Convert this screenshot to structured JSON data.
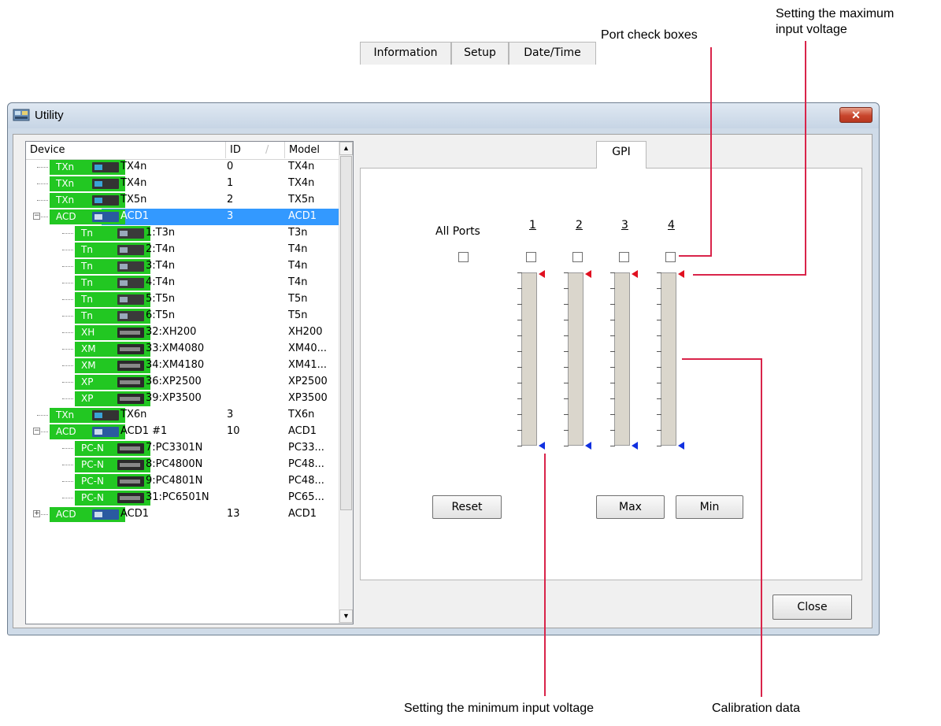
{
  "callouts": {
    "port_check_boxes": "Port check boxes",
    "max_voltage_line1": "Setting the maximum",
    "max_voltage_line2": "input voltage",
    "min_voltage": "Setting the minimum input voltage",
    "calibration": "Calibration data"
  },
  "window": {
    "title": "Utility",
    "close_glyph": "✕"
  },
  "tree": {
    "columns": {
      "device": "Device",
      "id": "ID",
      "sort_glyph": "/",
      "model": "Model"
    },
    "rows": [
      {
        "tag": "TXn",
        "label": "TX4n",
        "id": "0",
        "model": "TX4n",
        "level": 1,
        "thumb": "amp"
      },
      {
        "tag": "TXn",
        "label": "TX4n",
        "id": "1",
        "model": "TX4n",
        "level": 1,
        "thumb": "amp"
      },
      {
        "tag": "TXn",
        "label": "TX5n",
        "id": "2",
        "model": "TX5n",
        "level": 1,
        "thumb": "amp"
      },
      {
        "tag": "ACD",
        "label": "ACD1",
        "id": "3",
        "model": "ACD1",
        "level": 1,
        "thumb": "acd",
        "expander": "−",
        "selected": true
      },
      {
        "tag": "Tn",
        "label": "1:T3n",
        "id": "",
        "model": "T3n",
        "level": 2,
        "thumb": "tn"
      },
      {
        "tag": "Tn",
        "label": "2:T4n",
        "id": "",
        "model": "T4n",
        "level": 2,
        "thumb": "tn"
      },
      {
        "tag": "Tn",
        "label": "3:T4n",
        "id": "",
        "model": "T4n",
        "level": 2,
        "thumb": "tn"
      },
      {
        "tag": "Tn",
        "label": "4:T4n",
        "id": "",
        "model": "T4n",
        "level": 2,
        "thumb": "tn"
      },
      {
        "tag": "Tn",
        "label": "5:T5n",
        "id": "",
        "model": "T5n",
        "level": 2,
        "thumb": "tn"
      },
      {
        "tag": "Tn",
        "label": "6:T5n",
        "id": "",
        "model": "T5n",
        "level": 2,
        "thumb": "tn"
      },
      {
        "tag": "XH",
        "label": "32:XH200",
        "id": "",
        "model": "XH200",
        "level": 2,
        "thumb": "rack"
      },
      {
        "tag": "XM",
        "label": "33:XM4080",
        "id": "",
        "model": "XM40...",
        "level": 2,
        "thumb": "rack"
      },
      {
        "tag": "XM",
        "label": "34:XM4180",
        "id": "",
        "model": "XM41...",
        "level": 2,
        "thumb": "rack"
      },
      {
        "tag": "XP",
        "label": "36:XP2500",
        "id": "",
        "model": "XP2500",
        "level": 2,
        "thumb": "rack"
      },
      {
        "tag": "XP",
        "label": "39:XP3500",
        "id": "",
        "model": "XP3500",
        "level": 2,
        "thumb": "rack"
      },
      {
        "tag": "TXn",
        "label": "TX6n",
        "id": "3",
        "model": "TX6n",
        "level": 1,
        "thumb": "amp"
      },
      {
        "tag": "ACD",
        "label": "ACD1 #1",
        "id": "10",
        "model": "ACD1",
        "level": 1,
        "thumb": "acd",
        "expander": "−"
      },
      {
        "tag": "PC-N",
        "label": "7:PC3301N",
        "id": "",
        "model": "PC33...",
        "level": 2,
        "thumb": "rack"
      },
      {
        "tag": "PC-N",
        "label": "8:PC4800N",
        "id": "",
        "model": "PC48...",
        "level": 2,
        "thumb": "rack"
      },
      {
        "tag": "PC-N",
        "label": "9:PC4801N",
        "id": "",
        "model": "PC48...",
        "level": 2,
        "thumb": "rack"
      },
      {
        "tag": "PC-N",
        "label": "31:PC6501N",
        "id": "",
        "model": "PC65...",
        "level": 2,
        "thumb": "rack"
      },
      {
        "tag": "ACD",
        "label": "ACD1",
        "id": "13",
        "model": "ACD1",
        "level": 1,
        "thumb": "acd",
        "expander": "+"
      }
    ],
    "scroll_up": "▲",
    "scroll_down": "▼"
  },
  "tabs": [
    {
      "label": "Information",
      "active": false
    },
    {
      "label": "Setup",
      "active": false
    },
    {
      "label": "Date/Time",
      "active": false
    },
    {
      "label": "GPI",
      "active": true
    }
  ],
  "gpi": {
    "all_ports_label": "All Ports",
    "ports": [
      "1",
      "2",
      "3",
      "4"
    ],
    "reset_label": "Reset",
    "max_label": "Max",
    "min_label": "Min"
  },
  "close_label": "Close",
  "colors": {
    "tag_green": "#22c722",
    "selection": "#3399ff",
    "max_marker": "#e01020",
    "min_marker": "#1030e0",
    "callout_line": "#d9244a"
  }
}
